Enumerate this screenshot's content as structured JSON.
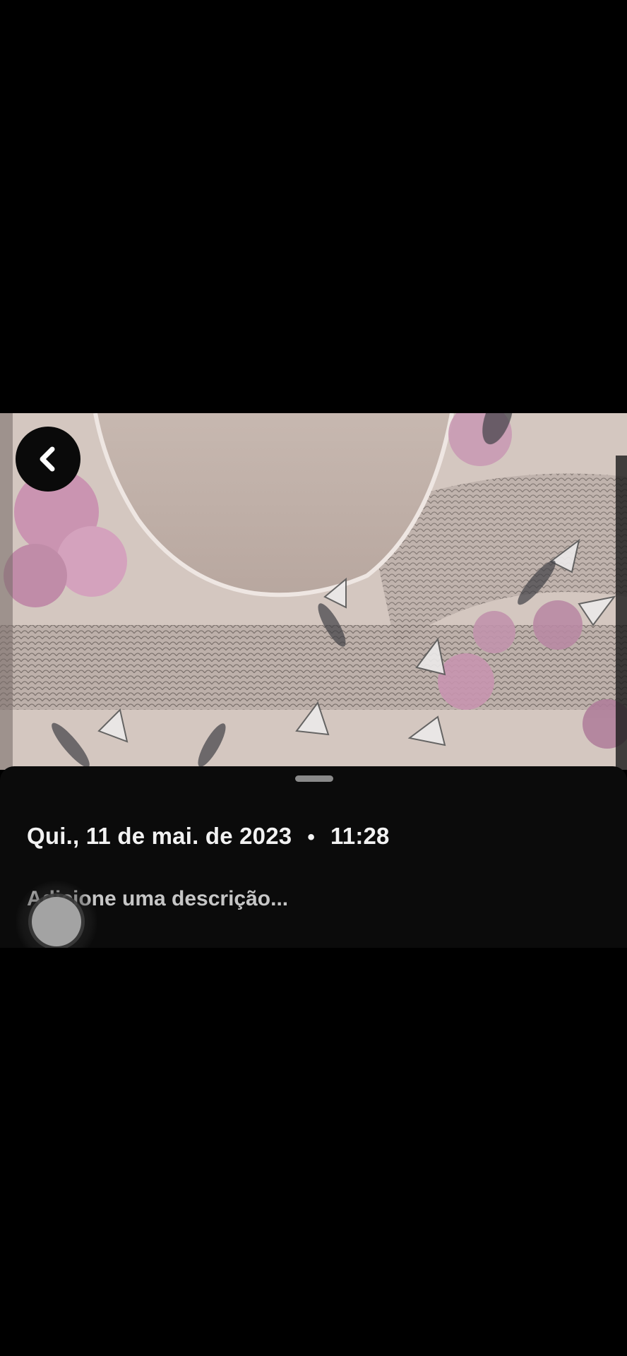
{
  "photo": {
    "subject": "floral-top-photo"
  },
  "back_button": {
    "icon": "chevron-left-icon"
  },
  "info_sheet": {
    "date": "Qui., 11 de mai. de 2023",
    "separator": "•",
    "time": "11:28",
    "description_placeholder": "Adicione uma descrição..."
  },
  "colors": {
    "background": "#000000",
    "sheet": "#0b0b0b",
    "text": "#f2f2f2",
    "placeholder": "#c6c6c6",
    "handle": "#8a8a8a"
  }
}
